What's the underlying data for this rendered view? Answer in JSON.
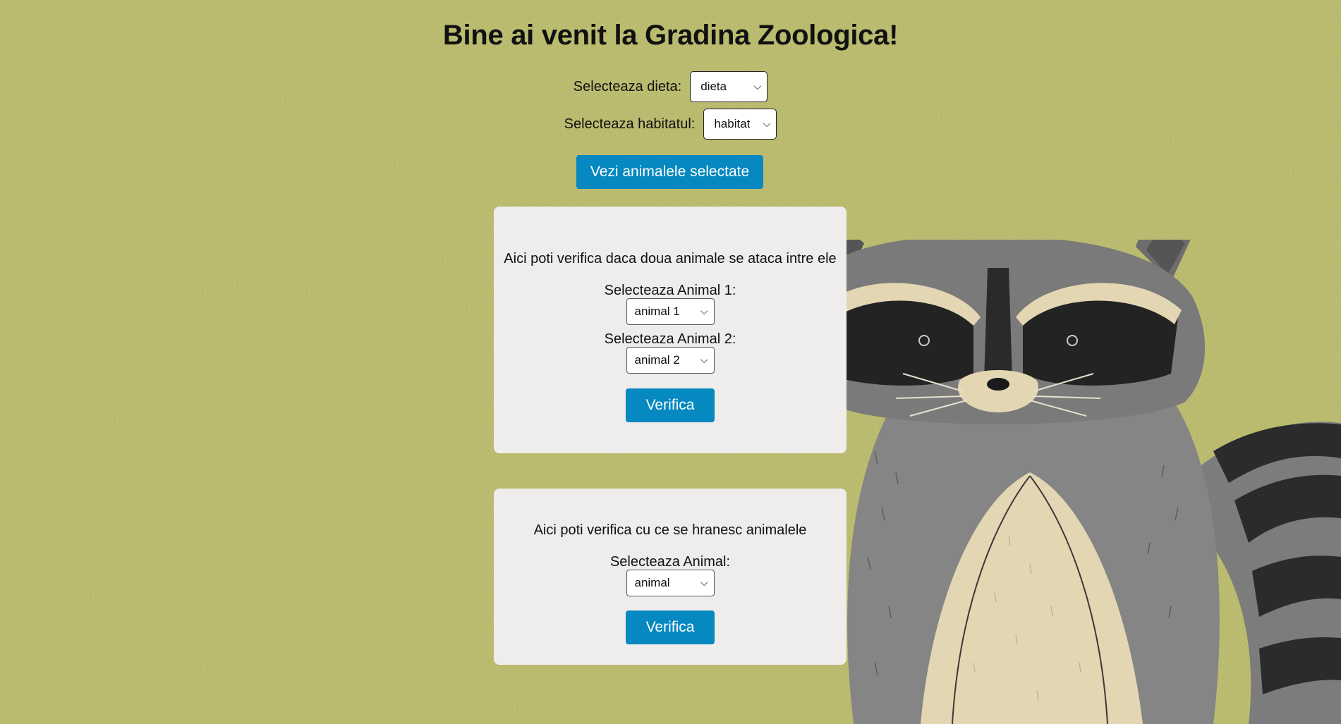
{
  "header": {
    "title": "Bine ai venit la Gradina Zoologica!"
  },
  "filters": {
    "diet_label": "Selecteaza dieta:",
    "diet_value": "dieta",
    "habitat_label": "Selecteaza habitatul:",
    "habitat_value": "habitat",
    "show_button": "Vezi animalele selectate"
  },
  "attack_card": {
    "prompt": "Aici poti verifica daca doua animale se ataca intre ele",
    "animal1_label": "Selecteaza Animal 1:",
    "animal1_value": "animal 1",
    "animal2_label": "Selecteaza Animal 2:",
    "animal2_value": "animal 2",
    "button": "Verifica"
  },
  "food_card": {
    "prompt": "Aici poti verifica cu ce se hranesc animalele",
    "animal_label": "Selecteaza Animal:",
    "animal_value": "animal",
    "button": "Verifica"
  },
  "icons": {
    "dropdown": "chevron-down-icon",
    "background": "raccoon-illustration"
  },
  "colors": {
    "background": "#bbbb6e",
    "button": "#0688c0",
    "card": "#efedec"
  }
}
